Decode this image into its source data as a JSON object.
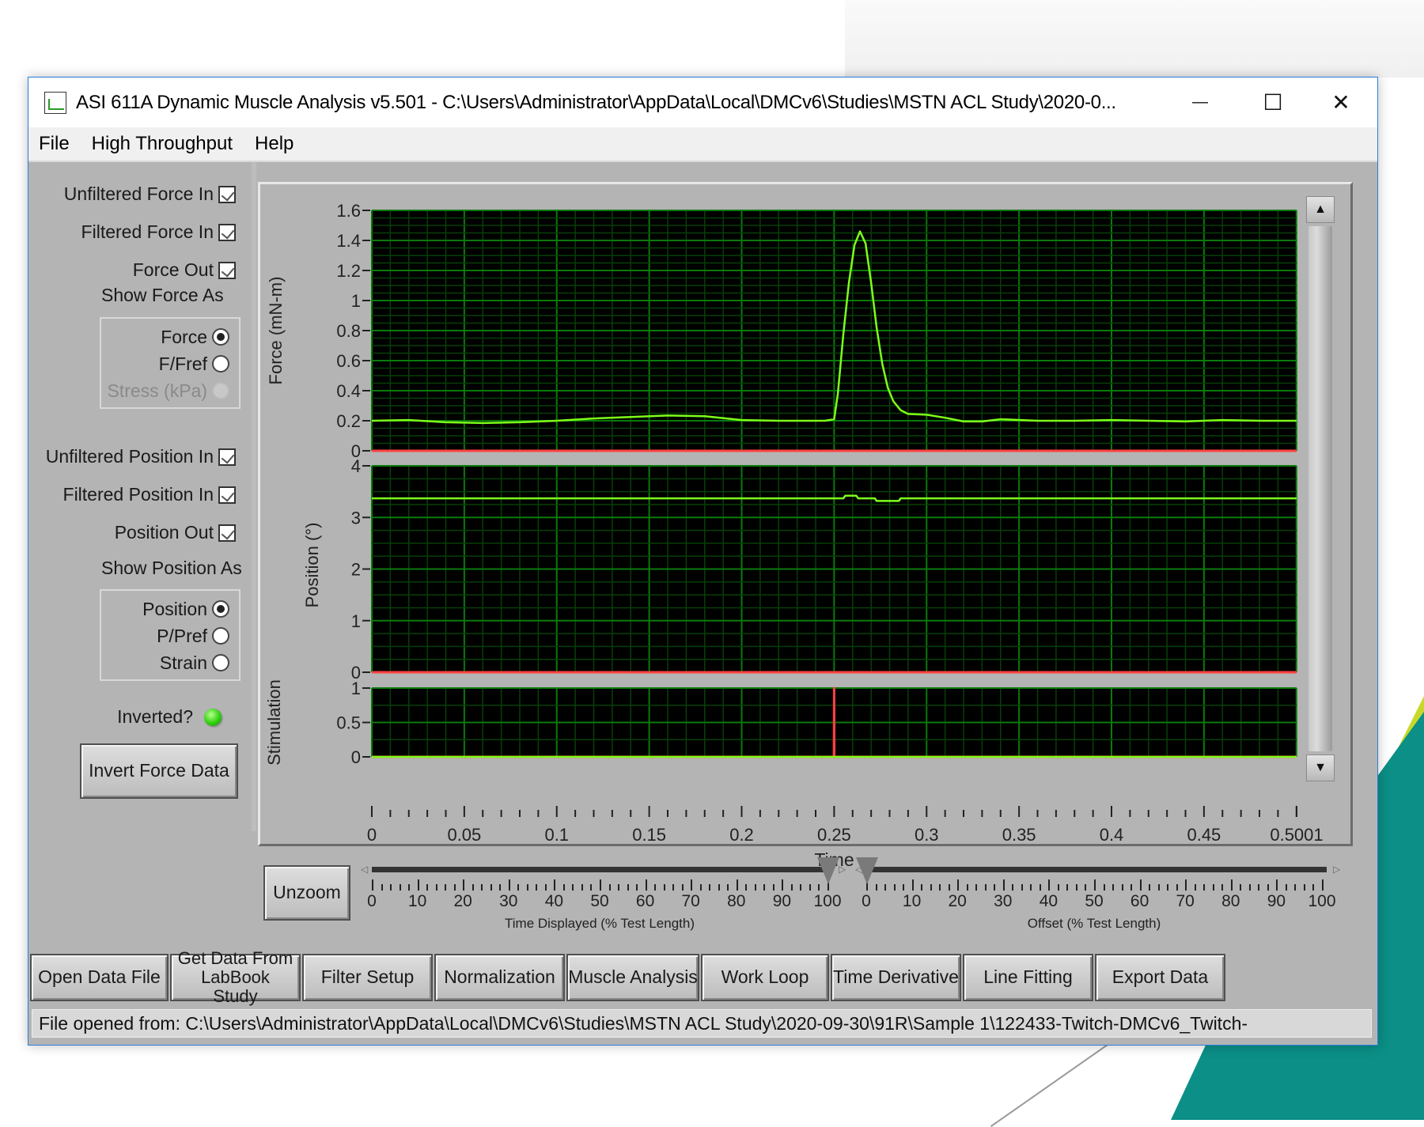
{
  "window": {
    "title": "ASI 611A Dynamic Muscle Analysis v5.501 - C:\\Users\\Administrator\\AppData\\Local\\DMCv6\\Studies\\MSTN ACL Study\\2020-0...",
    "minimize_glyph": "—",
    "maximize_glyph": "☐",
    "close_glyph": "✕"
  },
  "menu": [
    "File",
    "High Throughput",
    "Help"
  ],
  "left_panel": {
    "force_checkboxes": [
      {
        "label": "Unfiltered Force In",
        "checked": true
      },
      {
        "label": "Filtered Force In",
        "checked": true
      },
      {
        "label": "Force Out",
        "checked": true
      }
    ],
    "show_force_as_label": "Show Force As",
    "force_options": [
      {
        "label": "Force",
        "selected": true,
        "enabled": true
      },
      {
        "label": "F/Fref",
        "selected": false,
        "enabled": true
      },
      {
        "label": "Stress (kPa)",
        "selected": false,
        "enabled": false
      }
    ],
    "position_checkboxes": [
      {
        "label": "Unfiltered Position In",
        "checked": true
      },
      {
        "label": "Filtered Position In",
        "checked": true
      },
      {
        "label": "Position Out",
        "checked": true
      }
    ],
    "show_position_as_label": "Show Position As",
    "position_options": [
      {
        "label": "Position",
        "selected": true
      },
      {
        "label": "P/Pref",
        "selected": false
      },
      {
        "label": "Strain",
        "selected": false
      }
    ],
    "inverted_label": "Inverted?",
    "inverted_led_on": true,
    "invert_button": "Invert Force Data"
  },
  "chart_data": [
    {
      "type": "line",
      "title": "",
      "ylabel": "Force (mN-m)",
      "xlabel": "Time",
      "xlim": [
        0,
        0.5001
      ],
      "ylim": [
        0,
        1.6
      ],
      "yticks": [
        "0",
        "0.2",
        "0.4",
        "0.6",
        "0.8",
        "1",
        "1.2",
        "1.4",
        "1.6"
      ],
      "grid": true,
      "series": [
        {
          "name": "Force",
          "color": "#7dff1a",
          "x": [
            0,
            0.02,
            0.04,
            0.06,
            0.08,
            0.1,
            0.12,
            0.14,
            0.16,
            0.18,
            0.2,
            0.22,
            0.245,
            0.25,
            0.252,
            0.255,
            0.258,
            0.261,
            0.264,
            0.267,
            0.27,
            0.273,
            0.276,
            0.279,
            0.282,
            0.286,
            0.29,
            0.3,
            0.31,
            0.32,
            0.33,
            0.34,
            0.36,
            0.38,
            0.4,
            0.42,
            0.44,
            0.46,
            0.48,
            0.5001
          ],
          "y": [
            0.2,
            0.205,
            0.19,
            0.185,
            0.19,
            0.2,
            0.215,
            0.225,
            0.235,
            0.23,
            0.205,
            0.2,
            0.2,
            0.21,
            0.38,
            0.78,
            1.12,
            1.37,
            1.46,
            1.38,
            1.12,
            0.82,
            0.58,
            0.42,
            0.33,
            0.27,
            0.245,
            0.24,
            0.22,
            0.195,
            0.195,
            0.21,
            0.2,
            0.2,
            0.205,
            0.2,
            0.195,
            0.205,
            0.2,
            0.2
          ]
        },
        {
          "name": "Force Out",
          "color": "#ff4040",
          "x": [
            0,
            0.5001
          ],
          "y": [
            0,
            0
          ]
        }
      ]
    },
    {
      "type": "line",
      "ylabel": "Position (°)",
      "xlim": [
        0,
        0.5001
      ],
      "ylim": [
        0,
        4
      ],
      "yticks": [
        "0",
        "1",
        "2",
        "3",
        "4"
      ],
      "grid": true,
      "series": [
        {
          "name": "Position",
          "color": "#7dff1a",
          "x": [
            0,
            0.255,
            0.256,
            0.262,
            0.263,
            0.272,
            0.273,
            0.285,
            0.286,
            0.5001
          ],
          "y": [
            3.37,
            3.37,
            3.42,
            3.42,
            3.37,
            3.37,
            3.32,
            3.32,
            3.37,
            3.37
          ]
        },
        {
          "name": "Position Out",
          "color": "#ff4040",
          "x": [
            0,
            0.5001
          ],
          "y": [
            0,
            0
          ]
        }
      ]
    },
    {
      "type": "line",
      "ylabel": "Stimulation",
      "xlim": [
        0,
        0.5001
      ],
      "ylim": [
        0,
        1
      ],
      "yticks": [
        "0",
        "0.5",
        "1"
      ],
      "grid": true,
      "series": [
        {
          "name": "Stimulation",
          "color": "#ff4040",
          "x": [
            0,
            0.2499,
            0.25,
            0.2501,
            0.5001
          ],
          "y": [
            0,
            0,
            1,
            0,
            0
          ]
        },
        {
          "name": "Baseline",
          "color": "#7dff1a",
          "x": [
            0,
            0.5001
          ],
          "y": [
            0,
            0
          ]
        }
      ]
    }
  ],
  "x_axis": {
    "label": "Time",
    "ticks": [
      "0",
      "0.05",
      "0.1",
      "0.15",
      "0.2",
      "0.25",
      "0.3",
      "0.35",
      "0.4",
      "0.45",
      "0.5001"
    ]
  },
  "scrollbar": {
    "up_glyph": "▲",
    "down_glyph": "▼"
  },
  "controls": {
    "unzoom_label": "Unzoom",
    "time_displayed": {
      "caption": "Time Displayed (% Test Length)",
      "value": 100,
      "ticks": [
        "0",
        "10",
        "20",
        "30",
        "40",
        "50",
        "60",
        "70",
        "80",
        "90",
        "100"
      ]
    },
    "offset": {
      "caption": "Offset (% Test Length)",
      "value": 0,
      "ticks": [
        "0",
        "10",
        "20",
        "30",
        "40",
        "50",
        "60",
        "70",
        "80",
        "90",
        "100"
      ]
    }
  },
  "toolbar": [
    "Open Data File",
    "Get Data From LabBook Study",
    "Filter Setup",
    "Normalization",
    "Muscle Analysis",
    "Work Loop",
    "Time Derivative",
    "Line Fitting",
    "Export Data"
  ],
  "status": "File opened from: C:\\Users\\Administrator\\AppData\\Local\\DMCv6\\Studies\\MSTN ACL Study\\2020-09-30\\91R\\Sample 1\\122433-Twitch-DMCv6_Twitch-"
}
